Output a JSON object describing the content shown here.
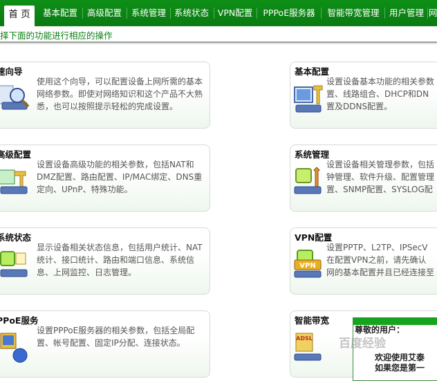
{
  "nav": {
    "tabs": [
      {
        "label": "首 页",
        "active": true
      },
      {
        "label": "基本配置"
      },
      {
        "label": "高级配置"
      },
      {
        "label": "系统管理"
      },
      {
        "label": "系统状态"
      },
      {
        "label": "VPN配置"
      },
      {
        "label": "PPPoE服务器"
      },
      {
        "label": "智能带宽管理"
      },
      {
        "label": "用户管理"
      },
      {
        "label": "网"
      }
    ]
  },
  "subbar": {
    "hint": "择下面的功能进行相应的操作"
  },
  "cards": {
    "wizard": {
      "title": "速向导",
      "desc": "使用这个向导，可以配置设备上网所需的基本网络参数。即使对网络知识和这个产品不大熟悉，也可以按照提示轻松的完成设置。"
    },
    "basic": {
      "title": "基本配置",
      "desc_lines": [
        "设置设备基本功能的相关参数",
        "置、线路组合、DHCP和DN",
        "置及DDNS配置。"
      ]
    },
    "advanced": {
      "title": "高级配置",
      "desc": "设置设备高级功能的相关参数，包括NAT和DMZ配置、路由配置、IP/MAC绑定、DNS重定向、UPnP、特殊功能。"
    },
    "sysmgmt": {
      "title": "系统管理",
      "desc_lines": [
        "设置设备相关管理参数，包括",
        "钟管理、软件升级、配置管理",
        "置、SNMP配置、SYSLOG配"
      ]
    },
    "status": {
      "title": "系统状态",
      "desc": "显示设备相关状态信息，包括用户统计、NAT统计、接口统计、路由和端口信息、系统信息、上网监控、日志管理。"
    },
    "vpn": {
      "title": "VPN配置",
      "desc_lines": [
        "设置PPTP、L2TP、IPSecV",
        "在配置VPN之前，请先确认",
        "网的基本配置并且已经连接至"
      ]
    },
    "pppoe": {
      "title": "PPoE服务",
      "desc": "设置PPPoE服务器的相关参数，包括全局配置、帐号配置、固定IP分配、连接状态。"
    },
    "bandwidth": {
      "title": "智能带宽",
      "icon_text": "ADSL"
    }
  },
  "popup": {
    "greeting": "尊敬的用户：",
    "line1": "欢迎使用艾泰",
    "line2": "如果您是第一"
  },
  "watermark": "百度经验",
  "colors": {
    "nav_green": "#0a7a12",
    "hint_green": "#0a7d12",
    "card_border": "#d4dcd4"
  }
}
